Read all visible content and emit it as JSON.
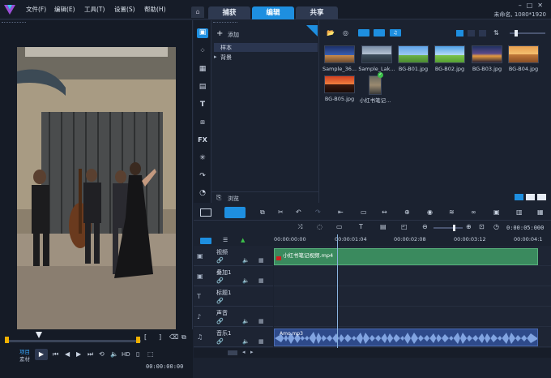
{
  "menu": [
    "文件(F)",
    "编辑(E)",
    "工具(T)",
    "设置(S)",
    "帮助(H)"
  ],
  "tabs": [
    "捕获",
    "编辑",
    "共享"
  ],
  "active_tab": "编辑",
  "project": {
    "name": "未命名, 1080*1920"
  },
  "library": {
    "add_label": "添加",
    "tree": [
      "样本",
      "背景"
    ],
    "browse_label": "浏览",
    "thumbs": [
      {
        "label": "Sample_36..."
      },
      {
        "label": "Sample_Lak..."
      },
      {
        "label": "BG-B01.jpg"
      },
      {
        "label": "BG-B02.jpg"
      },
      {
        "label": "BG-B03.jpg"
      },
      {
        "label": "BG-B04.jpg"
      },
      {
        "label": "BG-B05.jpg"
      },
      {
        "label": "小红书笔记..."
      }
    ]
  },
  "player": {
    "project_label": "项目",
    "clip_label": "素材",
    "hd_label": "HD",
    "timecode": "00:00:00:00"
  },
  "timeline": {
    "ruler": [
      "00:00:00:00",
      "00:00:01:04",
      "00:00:02:08",
      "00:00:03:12",
      "00:00:04:1"
    ],
    "duration": "0:00:05:000",
    "tracks": [
      {
        "name": "视频",
        "icon": "video-track-icon"
      },
      {
        "name": "叠加1",
        "icon": "overlay-track-icon"
      },
      {
        "name": "标题1",
        "icon": "title-track-icon"
      },
      {
        "name": "声音",
        "icon": "voice-track-icon"
      },
      {
        "name": "音乐1",
        "icon": "music-track-icon"
      }
    ],
    "video_clip": "小红书笔记视频.mp4",
    "audio_clip": "Amo.mp3"
  }
}
